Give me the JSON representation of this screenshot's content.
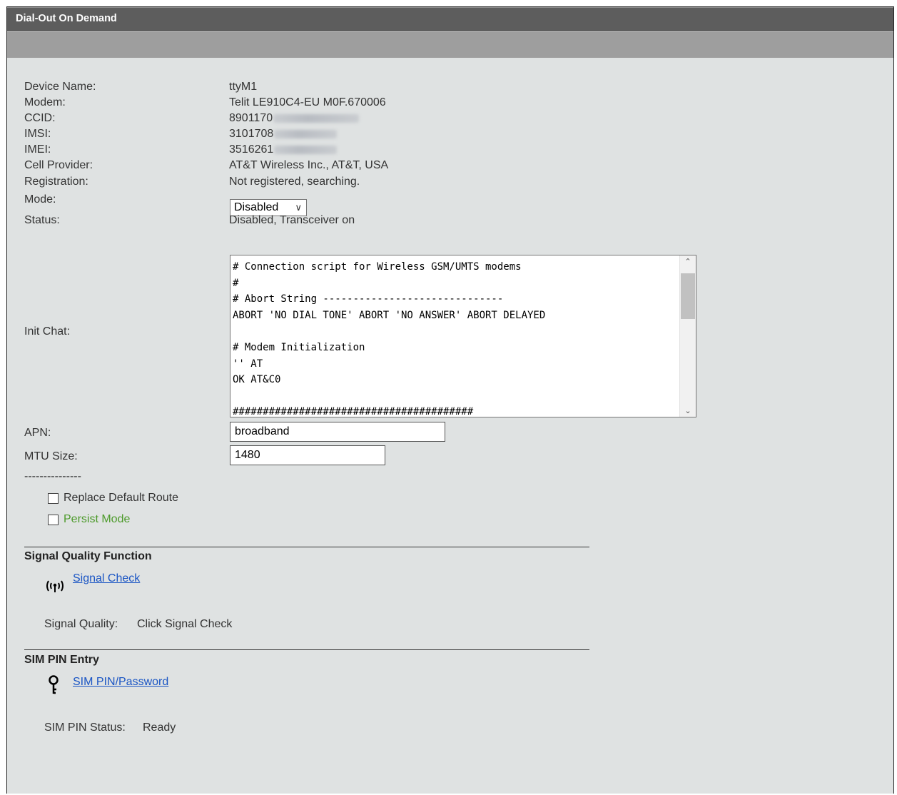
{
  "window": {
    "title": "Dial-Out On Demand"
  },
  "device": {
    "device_name_label": "Device Name:",
    "device_name_value": "ttyM1",
    "modem_label": "Modem:",
    "modem_value": "Telit LE910C4-EU M0F.670006",
    "ccid_label": "CCID:",
    "ccid_value": "8901170",
    "imsi_label": "IMSI:",
    "imsi_value": "3101708",
    "imei_label": "IMEI:",
    "imei_value": "3516261",
    "provider_label": "Cell Provider:",
    "provider_value": "AT&T Wireless Inc., AT&T, USA",
    "registration_label": "Registration:",
    "registration_value": "Not registered, searching.",
    "mode_label": "Mode:",
    "mode_value": "Disabled",
    "status_label": "Status:",
    "status_value": "Disabled, Transceiver on"
  },
  "init_chat": {
    "label": "Init Chat:",
    "text": "# Connection script for Wireless GSM/UMTS modems\n#\n# Abort String ------------------------------\nABORT 'NO DIAL TONE' ABORT 'NO ANSWER' ABORT DELAYED\n\n# Modem Initialization\n'' AT\nOK AT&C0\n\n########################################"
  },
  "apn": {
    "label": "APN:",
    "value": "broadband"
  },
  "mtu": {
    "label": "MTU Size:",
    "value": "1480"
  },
  "separator_text": "---------------",
  "options": {
    "replace_default_route": {
      "label": "Replace Default Route",
      "checked": false
    },
    "persist_mode": {
      "label": "Persist Mode",
      "checked": false,
      "color": "#4c9a2a"
    }
  },
  "signal": {
    "section_title": "Signal Quality Function",
    "icon": "antenna-icon",
    "link_label": "Signal Check",
    "quality_label": "Signal Quality:",
    "quality_value": "Click Signal Check"
  },
  "sim": {
    "section_title": "SIM PIN Entry",
    "icon": "key-icon",
    "link_label": "SIM PIN/Password",
    "status_label": "SIM PIN Status:",
    "status_value": "Ready"
  },
  "colors": {
    "titlebar": "#5d5d5d",
    "subbar": "#9e9e9e",
    "background": "#dfe2e2",
    "link": "#1a55c4"
  }
}
